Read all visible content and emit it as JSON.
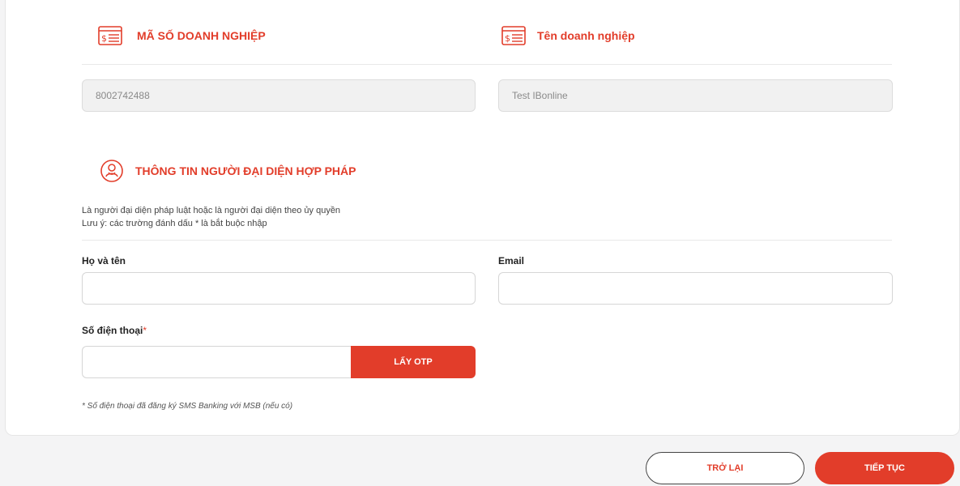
{
  "business": {
    "code_title": "MÃ SỐ DOANH NGHIỆP",
    "code_value": "8002742488",
    "name_title": "Tên doanh nghiệp",
    "name_value": "Test IBonline",
    "icon": "document-money-icon"
  },
  "representative": {
    "title": "THÔNG TIN NGƯỜI ĐẠI DIỆN HỢP PHÁP",
    "icon": "person-circle-icon",
    "note_line1": "Là người đại diện pháp luật hoặc là người đại diện theo ủy quyền",
    "note_line2": "Lưu ý: các trường đánh dấu * là bắt buộc nhập",
    "fullname_label": "Họ và tên",
    "fullname_value": "",
    "email_label": "Email",
    "email_value": "",
    "phone_label": "Số điện thoại",
    "required_mark": "*",
    "phone_value": "",
    "otp_button": "LẤY OTP",
    "phone_hint": "* Số điện thoại đã đăng ký SMS Banking với MSB (nếu có)"
  },
  "actions": {
    "back": "TRỞ LẠI",
    "next": "TIẾP TỤC"
  },
  "colors": {
    "accent": "#e23d2a"
  }
}
